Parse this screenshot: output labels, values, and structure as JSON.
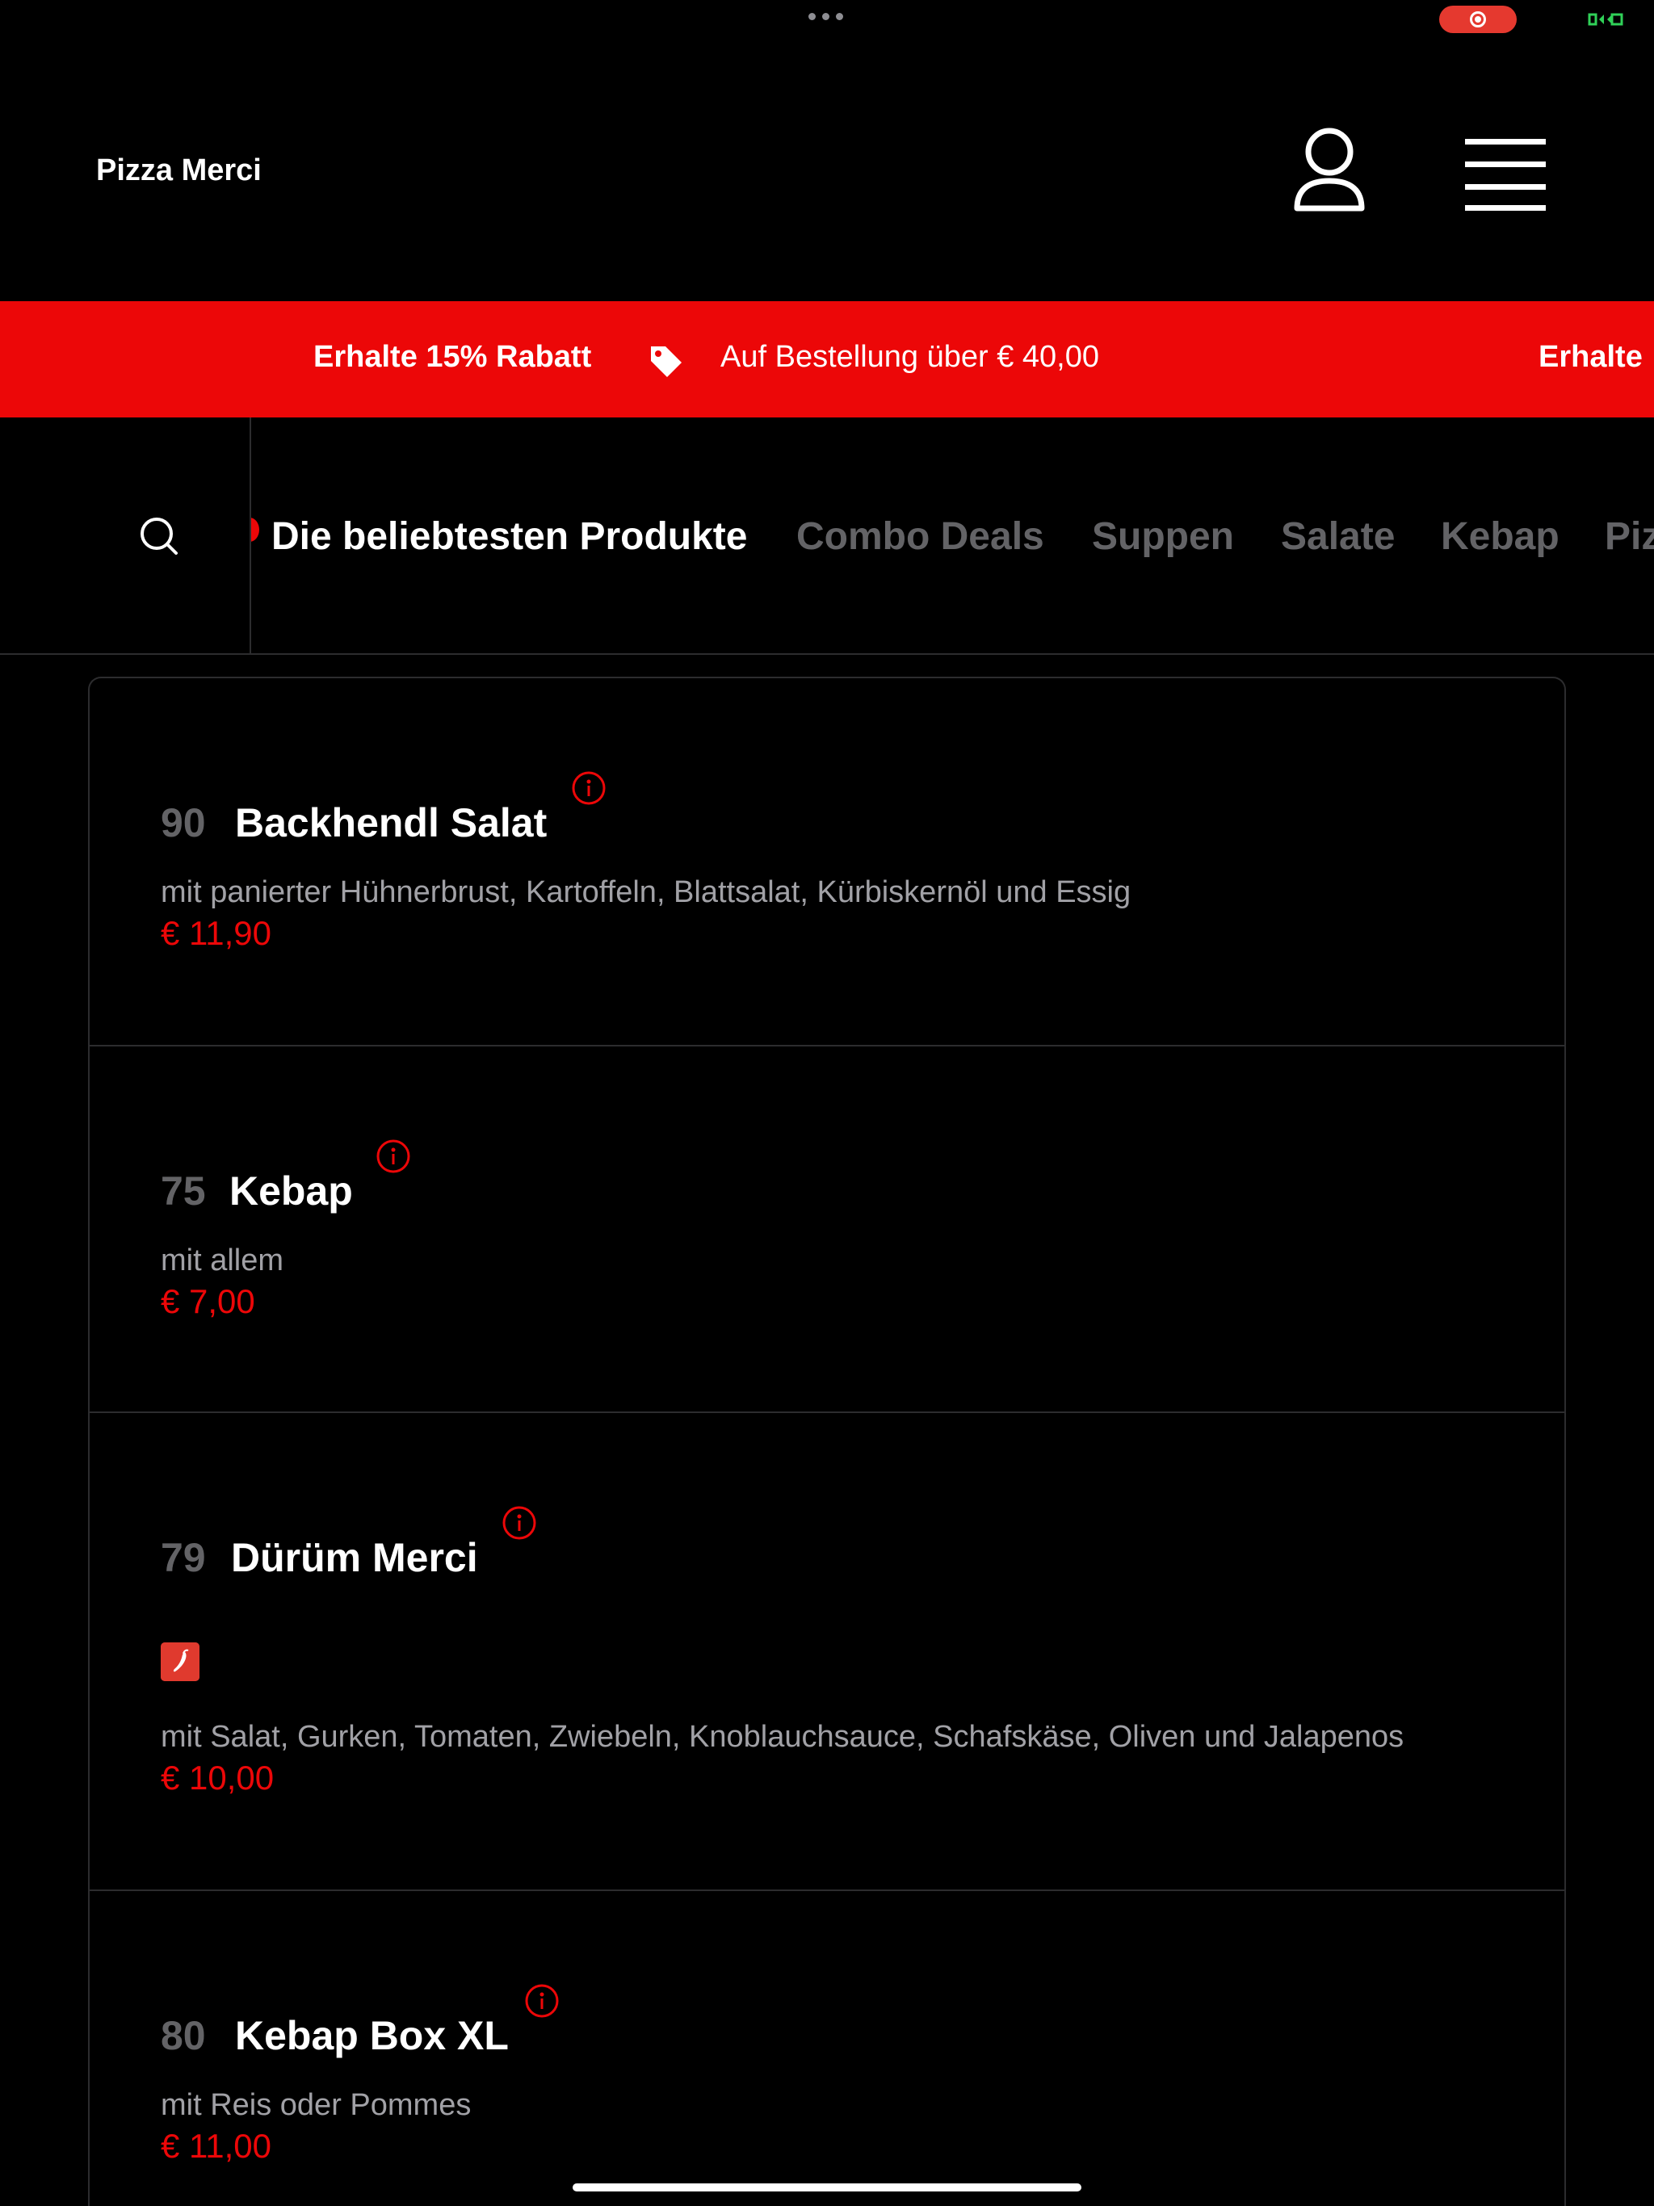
{
  "status": {
    "dots_icon": "more-dots-icon",
    "record_icon": "screen-record-icon",
    "camera_icon": "camera-icon"
  },
  "header": {
    "title": "Pizza Merci",
    "user_icon": "user-icon",
    "menu_icon": "hamburger-menu-icon"
  },
  "promo": {
    "headline": "Erhalte 15% Rabatt",
    "condition": "Auf Bestellung über € 40,00",
    "repeat_headline": "Erhalte",
    "icon": "tag-icon",
    "color": "#ec0708"
  },
  "categories": {
    "search_icon": "search-icon",
    "tabs": [
      {
        "label": "Die beliebtesten Produkte",
        "active": true
      },
      {
        "label": "Combo Deals",
        "active": false
      },
      {
        "label": "Suppen",
        "active": false
      },
      {
        "label": "Salate",
        "active": false
      },
      {
        "label": "Kebap",
        "active": false
      },
      {
        "label": "Pizza",
        "active": false
      }
    ]
  },
  "items": [
    {
      "number": "90",
      "name": "Backhendl Salat",
      "description": "mit panierter Hühnerbrust, Kartoffeln, Blattsalat, Kürbiskernöl und Essig",
      "price": "€ 11,90",
      "spicy": false
    },
    {
      "number": "75",
      "name": "Kebap",
      "description": "mit allem",
      "price": "€ 7,00",
      "spicy": false
    },
    {
      "number": "79",
      "name": "Dürüm Merci",
      "description": "mit Salat, Gurken, Tomaten, Zwiebeln, Knoblauchsauce, Schafskäse, Oliven und Jalapenos",
      "price": "€ 10,00",
      "spicy": true
    },
    {
      "number": "80",
      "name": "Kebap Box XL",
      "description": "mit Reis oder Pommes",
      "price": "€ 11,00",
      "spicy": false
    }
  ],
  "colors": {
    "accent": "#ec0708",
    "background": "#000000",
    "muted_text": "#636366",
    "description_text": "#a1a1a6"
  }
}
